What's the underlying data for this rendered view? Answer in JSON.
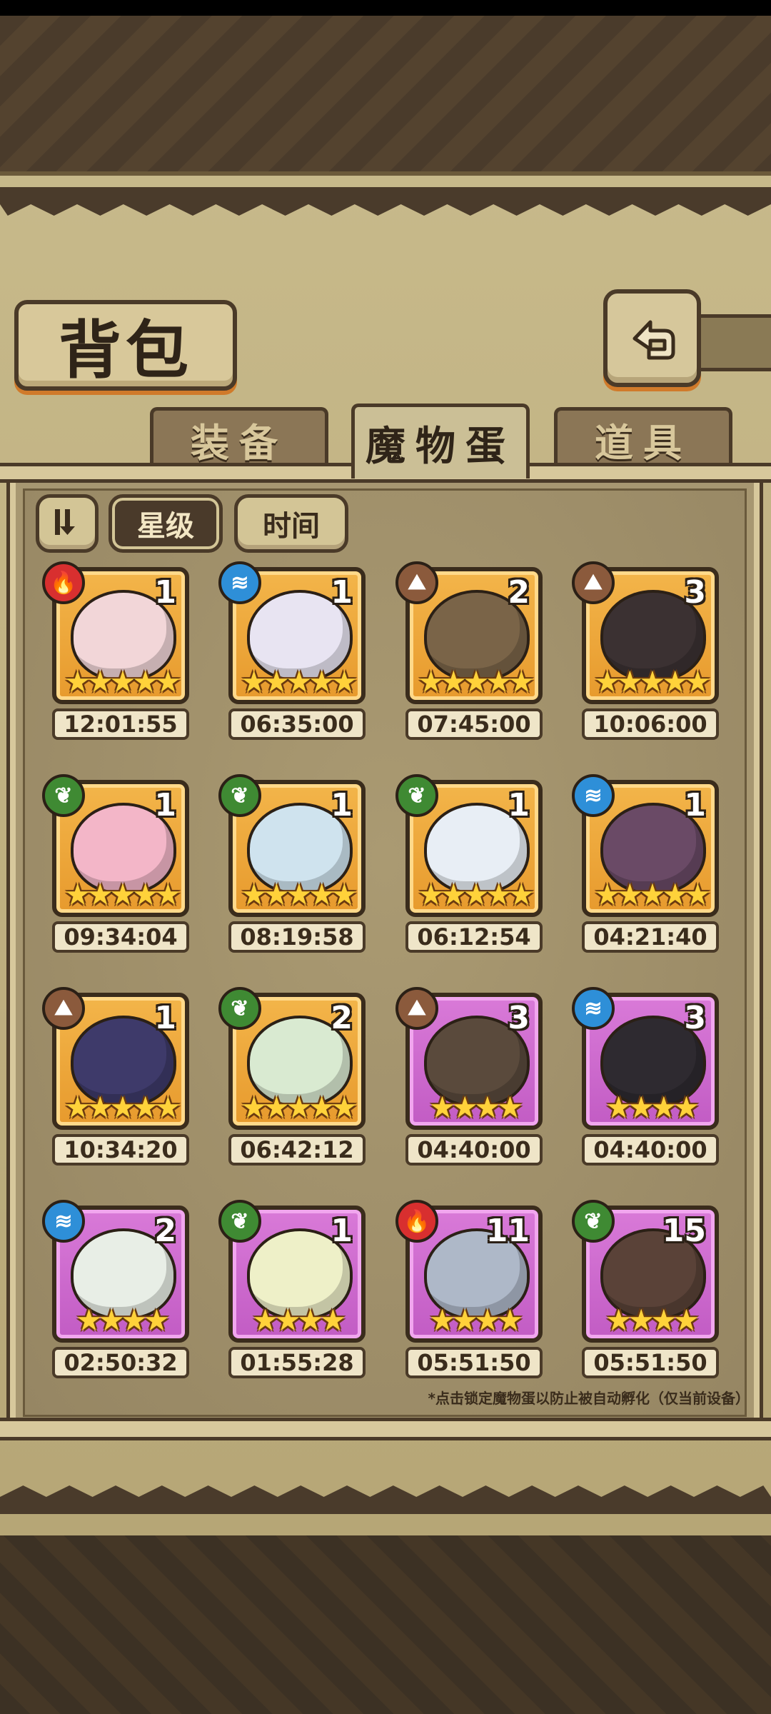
{
  "title": "背包",
  "tabs": [
    {
      "label": "装备",
      "active": false
    },
    {
      "label": "魔物蛋",
      "active": true
    },
    {
      "label": "道具",
      "active": false
    }
  ],
  "sort": {
    "star_label": "星级",
    "time_label": "时间"
  },
  "eggs": [
    {
      "count": "1",
      "stars": "★★★★★",
      "time": "12:01:55",
      "element": "fire",
      "rarity": "gold",
      "color": "#f2d6d8"
    },
    {
      "count": "1",
      "stars": "★★★★★",
      "time": "06:35:00",
      "element": "water",
      "rarity": "gold",
      "color": "#e8e4f2"
    },
    {
      "count": "2",
      "stars": "★★★★★",
      "time": "07:45:00",
      "element": "earth",
      "rarity": "gold",
      "color": "#7a6448"
    },
    {
      "count": "3",
      "stars": "★★★★★",
      "time": "10:06:00",
      "element": "earth",
      "rarity": "gold",
      "color": "#3b3132"
    },
    {
      "count": "1",
      "stars": "★★★★★",
      "time": "09:34:04",
      "element": "wood",
      "rarity": "gold",
      "color": "#f3b6c8"
    },
    {
      "count": "1",
      "stars": "★★★★★",
      "time": "08:19:58",
      "element": "wood",
      "rarity": "gold",
      "color": "#cfe3ee"
    },
    {
      "count": "1",
      "stars": "★★★★★",
      "time": "06:12:54",
      "element": "wood",
      "rarity": "gold",
      "color": "#e8eef5"
    },
    {
      "count": "1",
      "stars": "★★★★★",
      "time": "04:21:40",
      "element": "water",
      "rarity": "gold",
      "color": "#6a4a66"
    },
    {
      "count": "1",
      "stars": "★★★★★",
      "time": "10:34:20",
      "element": "earth",
      "rarity": "gold",
      "color": "#3e3a6a"
    },
    {
      "count": "2",
      "stars": "★★★★★",
      "time": "06:42:12",
      "element": "wood",
      "rarity": "gold",
      "color": "#d9ead1"
    },
    {
      "count": "3",
      "stars": "★★★★",
      "time": "04:40:00",
      "element": "earth",
      "rarity": "purple",
      "color": "#5a4a3c"
    },
    {
      "count": "3",
      "stars": "★★★★",
      "time": "04:40:00",
      "element": "water",
      "rarity": "purple",
      "color": "#2e2a30"
    },
    {
      "count": "2",
      "stars": "★★★★",
      "time": "02:50:32",
      "element": "water",
      "rarity": "purple",
      "color": "#e8eee6"
    },
    {
      "count": "1",
      "stars": "★★★★",
      "time": "01:55:28",
      "element": "wood",
      "rarity": "purple",
      "color": "#eef0c8"
    },
    {
      "count": "11",
      "stars": "★★★★",
      "time": "05:51:50",
      "element": "fire",
      "rarity": "purple",
      "color": "#aeb8c8"
    },
    {
      "count": "15",
      "stars": "★★★★",
      "time": "05:51:50",
      "element": "wood",
      "rarity": "purple",
      "color": "#5a4238"
    }
  ],
  "element_icons": {
    "fire": "fire-icon",
    "water": "water-icon",
    "earth": "mountain-icon",
    "wood": "leaf-icon"
  },
  "footnote": "*点击锁定魔物蛋以防止被自动孵化（仅当前设备）"
}
